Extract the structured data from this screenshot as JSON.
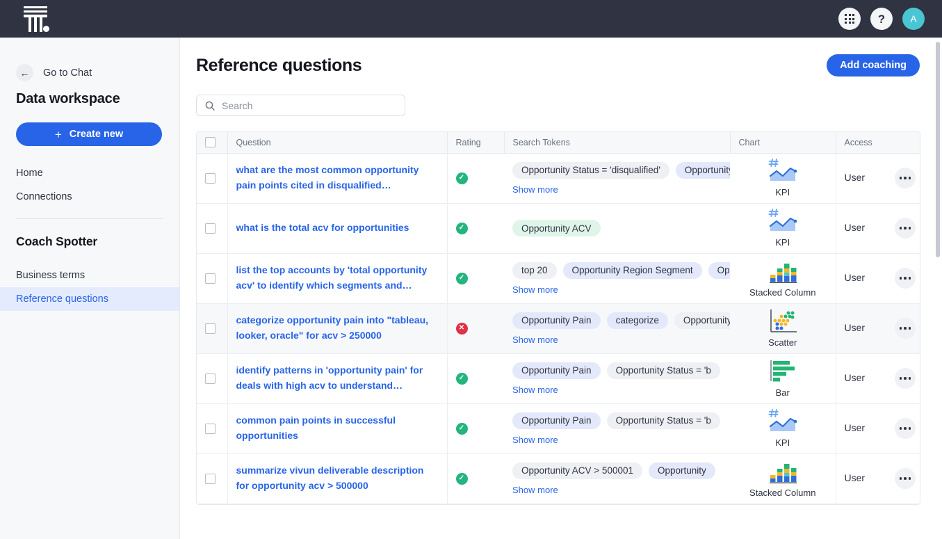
{
  "topbar": {
    "logo_name": "thoughtspot-logo",
    "apps_icon": "grid-apps-icon",
    "help_icon": "question-mark-icon",
    "avatar_initial": "A"
  },
  "sidebar": {
    "back_label": "Go to Chat",
    "back_icon": "arrow-left-icon",
    "workspace_title": "Data workspace",
    "create_button": "Create new",
    "create_icon": "plus-icon",
    "nav_items": [
      {
        "label": "Home",
        "active": false
      },
      {
        "label": "Connections",
        "active": false
      }
    ],
    "section_title": "Coach Spotter",
    "nav_items2": [
      {
        "label": "Business terms",
        "active": false
      },
      {
        "label": "Reference questions",
        "active": true
      }
    ]
  },
  "header": {
    "page_title": "Reference questions",
    "add_button": "Add coaching"
  },
  "search": {
    "placeholder": "Search",
    "value": "",
    "icon": "search-icon"
  },
  "table": {
    "columns": [
      "",
      "Question",
      "Rating",
      "Search Tokens",
      "Chart",
      "Access",
      ""
    ],
    "show_more_label": "Show more",
    "rows": [
      {
        "question": "what are the most common opportunity pain points cited in disqualified opportunities",
        "rating": "ok",
        "tokens": [
          {
            "text": "Opportunity Status = 'disqualified'",
            "style": "gray"
          },
          {
            "text": "Opportunity Pain",
            "style": "blue"
          }
        ],
        "show_more": true,
        "chart": "KPI",
        "chart_icon": "kpi-icon",
        "access": "User",
        "hover": false
      },
      {
        "question": "what is the total acv for opportunities",
        "rating": "ok",
        "tokens": [
          {
            "text": "Opportunity ACV",
            "style": "green"
          }
        ],
        "show_more": false,
        "chart": "KPI",
        "chart_icon": "kpi-icon",
        "access": "User",
        "hover": false
      },
      {
        "question": "list the top accounts by 'total opportunity acv' to identify which segments and region…",
        "rating": "ok",
        "tokens": [
          {
            "text": "top 20",
            "style": "gray"
          },
          {
            "text": "Opportunity Region Segment",
            "style": "blue"
          },
          {
            "text": "Opportunity",
            "style": "blue"
          }
        ],
        "show_more": true,
        "chart": "Stacked Column",
        "chart_icon": "stacked-column-icon",
        "access": "User",
        "hover": false
      },
      {
        "question": "categorize opportunity pain into \"tableau, looker, oracle\" for acv > 250000",
        "rating": "bad",
        "tokens": [
          {
            "text": "Opportunity Pain",
            "style": "blue"
          },
          {
            "text": "categorize",
            "style": "blue"
          },
          {
            "text": "Opportunity",
            "style": "gray"
          }
        ],
        "show_more": true,
        "chart": "Scatter",
        "chart_icon": "scatter-icon",
        "access": "User",
        "hover": true
      },
      {
        "question": "identify patterns in 'opportunity pain' for deals with high acv to understand commo…",
        "rating": "ok",
        "tokens": [
          {
            "text": "Opportunity Pain",
            "style": "blue"
          },
          {
            "text": "Opportunity Status = 'b",
            "style": "gray"
          }
        ],
        "show_more": true,
        "chart": "Bar",
        "chart_icon": "bar-icon",
        "access": "User",
        "hover": false
      },
      {
        "question": "common pain points in successful opportunities",
        "rating": "ok",
        "tokens": [
          {
            "text": "Opportunity Pain",
            "style": "blue"
          },
          {
            "text": "Opportunity Status = 'b",
            "style": "gray"
          }
        ],
        "show_more": true,
        "chart": "KPI",
        "chart_icon": "kpi-icon",
        "access": "User",
        "hover": false
      },
      {
        "question": "summarize vivun deliverable description for opportunity acv > 500000",
        "rating": "ok",
        "tokens": [
          {
            "text": "Opportunity ACV > 500001",
            "style": "gray"
          },
          {
            "text": "Opportunity",
            "style": "blue"
          }
        ],
        "show_more": true,
        "chart": "Stacked Column",
        "chart_icon": "stacked-column-icon",
        "access": "User",
        "hover": false
      }
    ]
  },
  "colors": {
    "accent": "#2764e7",
    "topbar": "#2f3342",
    "ok": "#24b47e",
    "bad": "#e03146",
    "avatar": "#49c5d4"
  }
}
